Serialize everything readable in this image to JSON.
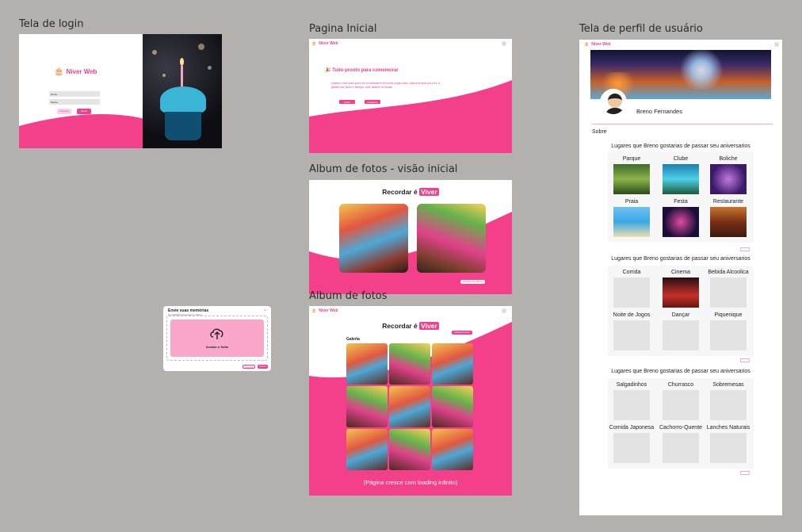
{
  "frames": {
    "login": {
      "title": "Tela de login",
      "brand": "Niver Web",
      "input1": "Nome",
      "input2": "Senha",
      "btn_cancel": "Cancelar",
      "btn_enter": "Entrar"
    },
    "home": {
      "title": "Pagina Inicial",
      "brand": "Niver Web",
      "headline": "🎉 Tudo pronto para comemorar",
      "body": "Quando você sabe quem for a chamada e tem bons vegan mais, valia a tempos pra cá fi. A gestão traz apoio e almejar. Usar detalhe do festas.",
      "btn1": "Entrar",
      "btn2": "Cadastrar"
    },
    "album_intro": {
      "title": "Album de fotos - visão inicial",
      "heading_prefix": "Recordar é ",
      "heading_highlight": "Viver",
      "cta": "Acessar seu album"
    },
    "album": {
      "title": "Album de fotos",
      "brand": "Niver Web",
      "heading_prefix": "Recordar é ",
      "heading_highlight": "Viver",
      "add_btn": "Adicionar fotos",
      "section": "Galeria",
      "footer": "(Página cresce com loading infinito)"
    },
    "upload": {
      "title": "Envie suas memórias",
      "subtitle": "Compartilhe seus fotos e vídeos",
      "drop_label": "Arraste o Solte",
      "btn_cancel": "Cancelar",
      "btn_send": "Enviar"
    },
    "profile": {
      "title": "Tela de perfil de usuário",
      "brand": "Niver Web",
      "user": "Breno Fernandes",
      "about": "Sobre",
      "sections": [
        {
          "title": "Lugares que Breno gostarias de passar seu aniversarios",
          "items": [
            "Parque",
            "Clube",
            "Boliche",
            "Praia",
            "Festa",
            "Restaurante"
          ]
        },
        {
          "title": "Lugares que Breno gostarias de passar seu aniversarios",
          "items": [
            "Corrida",
            "Cinema",
            "Bebida Alcoolica",
            "Noite de Jogos",
            "Dançar",
            "Piquenique"
          ]
        },
        {
          "title": "Lugares que Breno gostarias de passar seu aniversarios",
          "items": [
            "Salgadinhos",
            "Churrasco",
            "Sobremesas",
            "Comida Japonesa",
            "Cachorro-Quente",
            "Lanches Naturais"
          ]
        }
      ]
    }
  }
}
